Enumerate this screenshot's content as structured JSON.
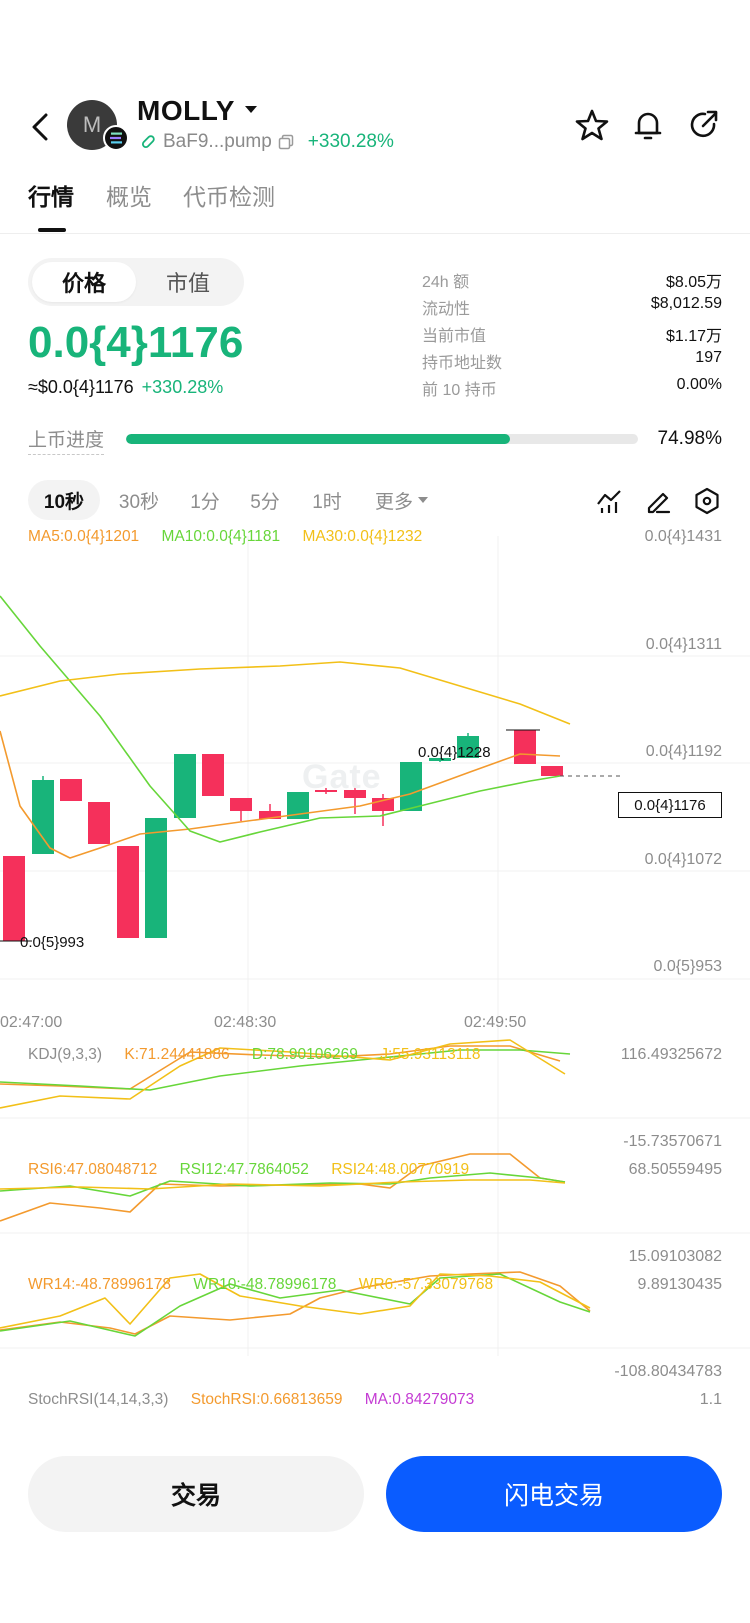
{
  "header": {
    "token_name": "MOLLY",
    "avatar_letter": "M",
    "address": "BaF9...pump",
    "change": "+330.28%"
  },
  "tabs": [
    {
      "label": "行情",
      "active": true
    },
    {
      "label": "概览",
      "active": false
    },
    {
      "label": "代币检测",
      "active": false
    }
  ],
  "toggle": {
    "price": "价格",
    "market_cap": "市值",
    "selected": "价格"
  },
  "price": {
    "main": "0.0{4}1176",
    "usd": "≈$0.0{4}1176",
    "change": "+330.28%"
  },
  "stats": [
    {
      "label": "24h  额",
      "value": "$8.05万"
    },
    {
      "label": "流动性",
      "value": "$8,012.59"
    },
    {
      "label": "当前市值",
      "value": "$1.17万"
    },
    {
      "label": "持币地址数",
      "value": "197"
    },
    {
      "label": "前 10 持币",
      "value": "0.00%"
    }
  ],
  "progress": {
    "label": "上币进度",
    "value": "74.98%",
    "fraction": 0.7498
  },
  "intervals": [
    {
      "label": "10秒",
      "active": true
    },
    {
      "label": "30秒",
      "active": false
    },
    {
      "label": "1分",
      "active": false
    },
    {
      "label": "5分",
      "active": false
    },
    {
      "label": "1时",
      "active": false
    },
    {
      "label": "更多",
      "active": false
    }
  ],
  "chart_tools": [
    "indicator-icon",
    "draw-pen-icon",
    "settings-hexagon-icon"
  ],
  "chart": {
    "watermark": "Gate",
    "ma_legend": {
      "ma5": "MA5:0.0{4}1201",
      "ma10": "MA10:0.0{4}1181",
      "ma30": "MA30:0.0{4}1232"
    },
    "price_axis": [
      "0.0{4}1431",
      "0.0{4}1311",
      "0.0{4}1192",
      "0.0{4}1072",
      "0.0{5}953"
    ],
    "current_price_tag": "0.0{4}1176",
    "high_label": "0.0{4}1228",
    "low_label": "0.0{5}993",
    "time_axis": [
      "02:47:00",
      "02:48:30",
      "02:49:50"
    ],
    "kdj": {
      "name": "KDJ(9,3,3)",
      "k": "K:71.24441886",
      "d": "D:78.90106269",
      "j": "J:55.93113118",
      "top": "116.49325672",
      "bottom": "-15.73570671"
    },
    "rsi": {
      "r6": "RSI6:47.08048712",
      "r12": "RSI12:47.7864052",
      "r24": "RSI24:48.00770919",
      "top": "68.50559495",
      "bottom": "15.09103082"
    },
    "wr": {
      "w14": "WR14:-48.78996178",
      "w10": "WR10:-48.78996178",
      "w6": "WR6:-57.33079768",
      "top": "9.89130435",
      "bottom": "-108.80434783"
    },
    "stochrsi": {
      "name": "StochRSI(14,14,3,3)",
      "value": "StochRSI:0.66813659",
      "ma": "MA:0.84279073",
      "top": "1.1"
    },
    "colors": {
      "up": "#18b47a",
      "down": "#f5305b",
      "ma5": "#f39a2e",
      "ma10": "#67d63a",
      "ma30": "#f2c018",
      "stoch_ma": "#c43bd3"
    }
  },
  "buttons": {
    "trade": "交易",
    "flash_trade": "闪电交易"
  }
}
